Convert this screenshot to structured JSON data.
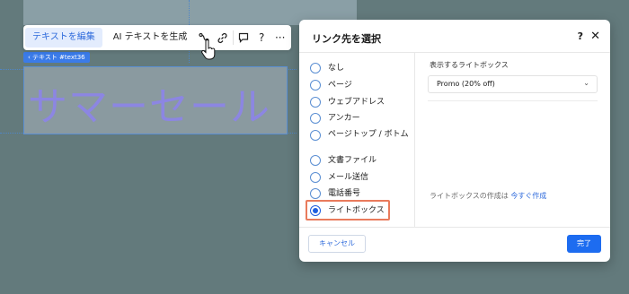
{
  "canvas": {
    "heading_text": "サマーセール",
    "element_tag": "‹ テキスト #text36"
  },
  "toolbar": {
    "edit_text_label": "テキストを編集",
    "ai_text_label": "AI テキストを生成",
    "icons": [
      "curve-icon",
      "link-icon",
      "comment-icon",
      "help-icon",
      "more-icon"
    ],
    "help_glyph": "?",
    "more_glyph": "···"
  },
  "dialog": {
    "title": "リンク先を選択",
    "help_glyph": "?",
    "close_glyph": "✕",
    "options": [
      {
        "label": "なし",
        "selected": false
      },
      {
        "label": "ページ",
        "selected": false
      },
      {
        "label": "ウェブアドレス",
        "selected": false
      },
      {
        "label": "アンカー",
        "selected": false
      },
      {
        "label": "ページトップ / ボトム",
        "selected": false
      },
      {
        "label": "文書ファイル",
        "selected": false
      },
      {
        "label": "メール送信",
        "selected": false
      },
      {
        "label": "電話番号",
        "selected": false
      },
      {
        "label": "ライトボックス",
        "selected": true
      }
    ],
    "right_panel": {
      "field_label": "表示するライトボックス",
      "selected_value": "Promo (20% off)",
      "footer_text": "ライトボックスの作成は",
      "footer_link": "今すぐ作成"
    },
    "cancel_label": "キャンセル",
    "done_label": "完了"
  },
  "colors": {
    "accent": "#1d6cf0",
    "highlight": "#e97b5c",
    "background": "#637a7c"
  }
}
